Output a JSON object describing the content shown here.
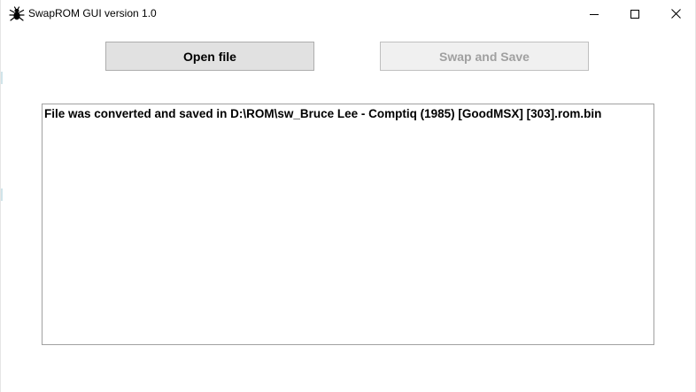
{
  "window": {
    "title": "SwapROM GUI version 1.0",
    "app_icon": "bug-icon"
  },
  "caption_buttons": {
    "minimize_icon": "minimize-icon",
    "maximize_icon": "maximize-icon",
    "close_icon": "close-icon"
  },
  "buttons": {
    "open_label": "Open file",
    "swap_label": "Swap and Save",
    "swap_enabled": false
  },
  "log": {
    "lines": [
      "File was converted and saved in D:\\ROM\\sw_Bruce Lee - Comptiq (1985) [GoodMSX] [303].rom.bin"
    ]
  },
  "colors": {
    "button_face": "#e1e1e1",
    "button_border": "#adadad",
    "disabled_text": "#a0a0a0",
    "textbox_border": "#a0a0a0"
  }
}
